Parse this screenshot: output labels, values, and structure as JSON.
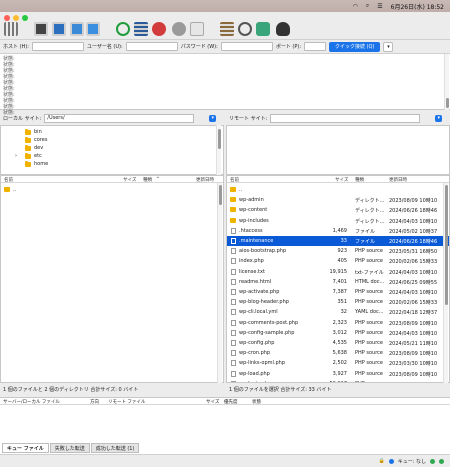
{
  "menubar": {
    "date": "6月26日(水) 18:52"
  },
  "quickconnect": {
    "host_label": "ホスト (H):",
    "user_label": "ユーザー名 (U):",
    "pass_label": "パスワード (W):",
    "port_label": "ポート (P):",
    "connect_label": "クイック接続 (Q)",
    "dropdown_icon": "chevron-down-icon"
  },
  "log": {
    "lines": [
      "状態:",
      "状態:",
      "状態:",
      "状態:",
      "状態:",
      "状態:",
      "状態:",
      "状態:",
      "状態:",
      "状態:"
    ]
  },
  "local": {
    "site_label": "ローカル サイト:",
    "path": "/Users/",
    "tree": [
      "bin",
      "cores",
      "dev",
      "etc",
      "home"
    ],
    "headers": {
      "name": "名前",
      "size": "サイズ",
      "type": "種類",
      "modified": "更新日時"
    },
    "files": [
      {
        "name": ".."
      }
    ],
    "status": "1 個のファイルと 2 個のディレクトリ 合計サイズ: 0 バイト"
  },
  "remote": {
    "site_label": "リモート サイト:",
    "headers": {
      "name": "名前",
      "size": "サイズ",
      "type": "種類",
      "modified": "更新日時"
    },
    "files": [
      {
        "name": "..",
        "size": "",
        "type": "",
        "modified": "",
        "folder": true
      },
      {
        "name": "wp-admin",
        "size": "",
        "type": "ディレクト...",
        "modified": "2023/08/09 10時10",
        "folder": true
      },
      {
        "name": "wp-content",
        "size": "",
        "type": "ディレクト...",
        "modified": "2024/06/26 18時46",
        "folder": true
      },
      {
        "name": "wp-includes",
        "size": "",
        "type": "ディレクト...",
        "modified": "2024/04/03 10時10",
        "folder": true
      },
      {
        "name": ".htaccess",
        "size": "1,469",
        "type": "ファイル",
        "modified": "2024/05/02 10時37",
        "folder": false
      },
      {
        "name": ".maintenance",
        "size": "33",
        "type": "ファイル",
        "modified": "2024/06/26 18時46",
        "folder": false,
        "selected": true
      },
      {
        "name": "aios-bootstrap.php",
        "size": "923",
        "type": "PHP source",
        "modified": "2023/05/31 16時50",
        "folder": false
      },
      {
        "name": "index.php",
        "size": "405",
        "type": "PHP source",
        "modified": "2020/02/06 15時33",
        "folder": false
      },
      {
        "name": "license.txt",
        "size": "19,915",
        "type": "txt-ファイル",
        "modified": "2024/04/03 10時10",
        "folder": false
      },
      {
        "name": "readme.html",
        "size": "7,401",
        "type": "HTML doc...",
        "modified": "2024/06/25 09時55",
        "folder": false
      },
      {
        "name": "wp-activate.php",
        "size": "7,387",
        "type": "PHP source",
        "modified": "2024/04/03 10時10",
        "folder": false
      },
      {
        "name": "wp-blog-header.php",
        "size": "351",
        "type": "PHP source",
        "modified": "2020/02/06 15時33",
        "folder": false
      },
      {
        "name": "wp-cli.local.yml",
        "size": "32",
        "type": "YAML doc...",
        "modified": "2022/04/18 12時37",
        "folder": false
      },
      {
        "name": "wp-comments-post.php",
        "size": "2,323",
        "type": "PHP source",
        "modified": "2023/08/09 10時10",
        "folder": false
      },
      {
        "name": "wp-config-sample.php",
        "size": "3,012",
        "type": "PHP source",
        "modified": "2024/04/03 10時10",
        "folder": false
      },
      {
        "name": "wp-config.php",
        "size": "4,535",
        "type": "PHP source",
        "modified": "2024/05/21 11時10",
        "folder": false
      },
      {
        "name": "wp-cron.php",
        "size": "5,638",
        "type": "PHP source",
        "modified": "2023/08/09 10時10",
        "folder": false
      },
      {
        "name": "wp-links-opml.php",
        "size": "2,502",
        "type": "PHP source",
        "modified": "2023/03/30 10時10",
        "folder": false
      },
      {
        "name": "wp-load.php",
        "size": "3,927",
        "type": "PHP source",
        "modified": "2023/08/09 10時10",
        "folder": false
      },
      {
        "name": "wp-login.php",
        "size": "50,917",
        "type": "PHP source",
        "modified": "2024/04/03 10時10",
        "folder": false
      },
      {
        "name": "wp-mail.php",
        "size": "8,525",
        "type": "PHP source",
        "modified": "2023/10/08 10時10",
        "folder": false
      }
    ],
    "status": "1 個のファイルを選択 合計サイズ: 33 バイト"
  },
  "queue": {
    "headers": {
      "server": "サーバー/ローカル ファイル",
      "direction": "方向",
      "remote": "リモート ファイル",
      "size": "サイズ",
      "priority": "優先度",
      "status": "状態"
    },
    "tabs": [
      "キュー ファイル",
      "失敗した転送",
      "成功した転送 (1)"
    ],
    "footer": "キュー: なし"
  },
  "colors": {
    "accent": "#1a73e8",
    "selection": "#0a5ad8",
    "folder": "#f0b400"
  }
}
